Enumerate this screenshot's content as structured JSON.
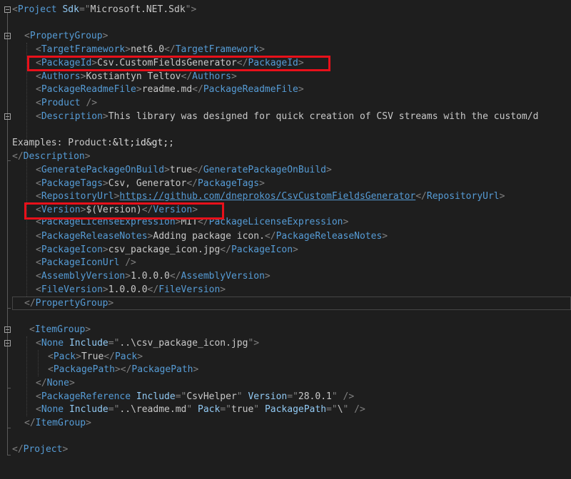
{
  "lines": {
    "l1": {
      "open": "<",
      "tag": "Project",
      "sp": " ",
      "attr": "Sdk",
      "eq": "=\"",
      "val": "Microsoft.NET.Sdk",
      "close": "\">"
    },
    "l3": {
      "open": "<",
      "tag": "PropertyGroup",
      "close": ">"
    },
    "l4": {
      "open": "<",
      "tag": "TargetFramework",
      "mid": ">",
      "text": "net6.0",
      "endopen": "</",
      "endtag": "TargetFramework",
      "close": ">"
    },
    "l5": {
      "open": "<",
      "tag": "PackageId",
      "mid": ">",
      "text": "Csv.CustomFieldsGenerator",
      "endopen": "</",
      "endtag": "PackageId",
      "close": ">"
    },
    "l6": {
      "open": "<",
      "tag": "Authors",
      "mid": ">",
      "text": "Kostiantyn Teltov",
      "endopen": "</",
      "endtag": "Authors",
      "close": ">"
    },
    "l7": {
      "open": "<",
      "tag": "PackageReadmeFile",
      "mid": ">",
      "text": "readme.md",
      "endopen": "</",
      "endtag": "PackageReadmeFile",
      "close": ">"
    },
    "l8": {
      "open": "<",
      "tag": "Product",
      "close": " />"
    },
    "l9": {
      "open": "<",
      "tag": "Description",
      "mid": ">",
      "text": "This library was designed for quick creation of CSV streams with the custom/d"
    },
    "l11": {
      "text": "Examples: Product:",
      "ent": "&lt;id&gt;",
      "semi": ";"
    },
    "l12": {
      "open": "</",
      "tag": "Description",
      "close": ">"
    },
    "l13": {
      "open": "<",
      "tag": "GeneratePackageOnBuild",
      "mid": ">",
      "text": "true",
      "endopen": "</",
      "endtag": "GeneratePackageOnBuild",
      "close": ">"
    },
    "l14": {
      "open": "<",
      "tag": "PackageTags",
      "mid": ">",
      "text": "Csv, Generator",
      "endopen": "</",
      "endtag": "PackageTags",
      "close": ">"
    },
    "l15": {
      "open": "<",
      "tag": "RepositoryUrl",
      "mid": ">",
      "link": "https://github.com/dneprokos/CsvCustomFieldsGenerator",
      "endopen": "</",
      "endtag": "RepositoryUrl",
      "close": ">"
    },
    "l16": {
      "open": "<",
      "tag": "Version",
      "mid": ">",
      "text": "$(Version)",
      "endopen": "</",
      "endtag": "Version",
      "close": ">"
    },
    "l17": {
      "open": "<",
      "tag": "PackageLicenseExpression",
      "mid": ">",
      "text": "MIT",
      "endopen": "</",
      "endtag": "PackageLicenseExpression",
      "close": ">"
    },
    "l18": {
      "open": "<",
      "tag": "PackageReleaseNotes",
      "mid": ">",
      "text": "Adding package icon.",
      "endopen": "</",
      "endtag": "PackageReleaseNotes",
      "close": ">"
    },
    "l19": {
      "open": "<",
      "tag": "PackageIcon",
      "mid": ">",
      "text": "csv_package_icon.jpg",
      "endopen": "</",
      "endtag": "PackageIcon",
      "close": ">"
    },
    "l20": {
      "open": "<",
      "tag": "PackageIconUrl",
      "close": " />"
    },
    "l21": {
      "open": "<",
      "tag": "AssemblyVersion",
      "mid": ">",
      "text": "1.0.0.0",
      "endopen": "</",
      "endtag": "AssemblyVersion",
      "close": ">"
    },
    "l22": {
      "open": "<",
      "tag": "FileVersion",
      "mid": ">",
      "text": "1.0.0.0",
      "endopen": "</",
      "endtag": "FileVersion",
      "close": ">"
    },
    "l23": {
      "open": "</",
      "tag": "PropertyGroup",
      "close": ">"
    },
    "l25": {
      "open": "<",
      "tag": "ItemGroup",
      "close": ">"
    },
    "l26": {
      "open": "<",
      "tag": "None",
      "sp": " ",
      "attr": "Include",
      "eq": "=\"",
      "val": "..\\csv_package_icon.jpg",
      "close": "\">"
    },
    "l27": {
      "open": "<",
      "tag": "Pack",
      "mid": ">",
      "text": "True",
      "endopen": "</",
      "endtag": "Pack",
      "close": ">"
    },
    "l28": {
      "open": "<",
      "tag": "PackagePath",
      "mid": "></",
      "endtag": "PackagePath",
      "close": ">"
    },
    "l29": {
      "open": "</",
      "tag": "None",
      "close": ">"
    },
    "l30": {
      "open": "<",
      "tag": "PackageReference",
      "sp": " ",
      "attr": "Include",
      "eq": "=\"",
      "val": "CsvHelper",
      "q": "\" ",
      "attr2": "Version",
      "eq2": "=\"",
      "val2": "28.0.1",
      "close": "\" />"
    },
    "l31": {
      "open": "<",
      "tag": "None",
      "sp": " ",
      "attr": "Include",
      "eq": "=\"",
      "val": "..\\readme.md",
      "q": "\" ",
      "attr2": "Pack",
      "eq2": "=\"",
      "val2": "true",
      "q2": "\" ",
      "attr3": "PackagePath",
      "eq3": "=\"",
      "val3": "\\",
      "close": "\" />"
    },
    "l32": {
      "open": "</",
      "tag": "ItemGroup",
      "close": ">"
    },
    "l34": {
      "open": "</",
      "tag": "Project",
      "close": ">"
    }
  },
  "colors": {
    "background": "#1e1e1e",
    "tag": "#569cd6",
    "attribute": "#92caf4",
    "text": "#c8c8c8",
    "delimiter": "#808080",
    "highlight": "#e8101a"
  },
  "icons": [
    "collapse-icon"
  ]
}
